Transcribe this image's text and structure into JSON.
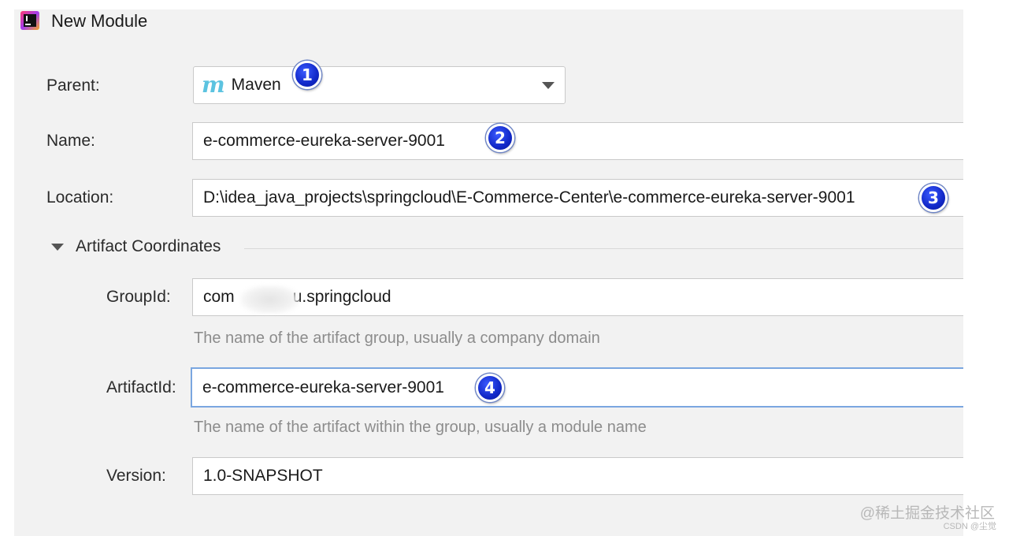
{
  "window": {
    "title": "New Module"
  },
  "form": {
    "parent": {
      "label": "Parent:",
      "value": "Maven",
      "icon": "maven-icon"
    },
    "name": {
      "label": "Name:",
      "value": "e-commerce-eureka-server-9001"
    },
    "location": {
      "label": "Location:",
      "value": "D:\\idea_java_projects\\springcloud\\E-Commerce-Center\\e-commerce-eureka-server-9001"
    }
  },
  "artifact": {
    "section_title": "Artifact Coordinates",
    "group_id": {
      "label": "GroupId:",
      "value_start": "com",
      "value_end": "u.springcloud",
      "hint": "The name of the artifact group, usually a company domain"
    },
    "artifact_id": {
      "label": "ArtifactId:",
      "value": "e-commerce-eureka-server-9001",
      "hint": "The name of the artifact within the group, usually a module name"
    },
    "version": {
      "label": "Version:",
      "value": "1.0-SNAPSHOT"
    }
  },
  "annotations": [
    "1",
    "2",
    "3",
    "4"
  ],
  "watermark": {
    "main": "@稀土掘金技术社区",
    "sub": "CSDN @尘觉"
  },
  "colors": {
    "badge": "#1128c8",
    "focus": "#7aa6e0",
    "maven": "#5cc3e0"
  }
}
